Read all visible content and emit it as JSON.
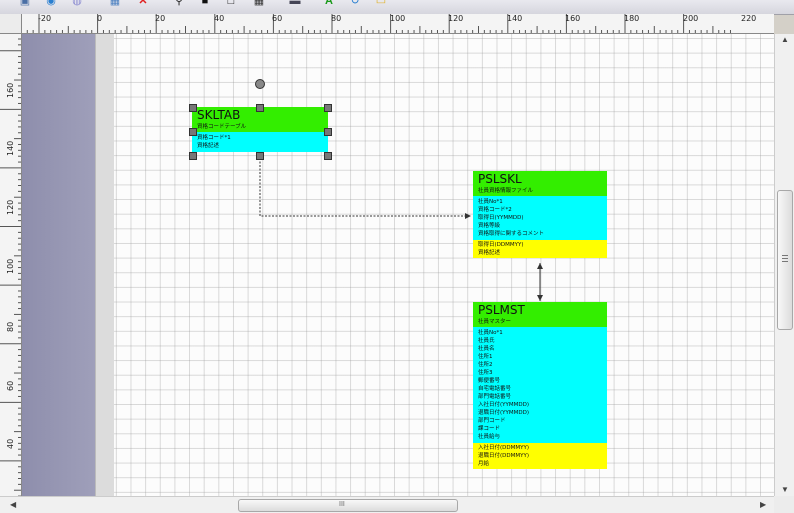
{
  "toolbar": {
    "icons": [
      "screenshot-icon",
      "globe-refresh-icon",
      "shapes-icon",
      "grid-toggle-icon",
      "delete-x-icon",
      "zoom-icon",
      "square-frame-icon",
      "page-icon",
      "grid-icon",
      "print-icon",
      "font-icon",
      "refresh-icon",
      "folder-icon"
    ]
  },
  "ruler": {
    "horizontal": [
      "-20",
      "0",
      "20",
      "40",
      "60",
      "80",
      "100",
      "120",
      "140",
      "160",
      "180",
      "200",
      "220"
    ],
    "vertical": [
      "160",
      "140",
      "120",
      "100",
      "80",
      "60",
      "40"
    ]
  },
  "scrollbar": {
    "grip": "III"
  },
  "tables": {
    "skltab": {
      "name": "SKLTAB",
      "comment": "資格コードテーブル",
      "cyan": [
        "資格コード*1",
        "資格記述"
      ],
      "yellow": []
    },
    "pslskl": {
      "name": "PSLSKL",
      "comment": "社員資格情報ファイル",
      "cyan": [
        "社員No*1",
        "資格コード*2",
        "取得日(YYMMDD)",
        "資格等級",
        "資格取得に関するコメント"
      ],
      "yellow": [
        "取得日(DDMMYY)",
        "資格記述"
      ]
    },
    "pslmst": {
      "name": "PSLMST",
      "comment": "社員マスター",
      "cyan": [
        "社員No*1",
        "社員氏",
        "社員名",
        "住所1",
        "住所2",
        "住所3",
        "郵便番号",
        "自宅電話番号",
        "部門電話番号",
        "入社日付(YYMMDD)",
        "退職日付(YYMMDD)",
        "部門コード",
        "課コード",
        "社員給与"
      ],
      "yellow": [
        "入社日付(DDMMYY)",
        "退職日付(DDMMYY)",
        "月給"
      ]
    }
  }
}
